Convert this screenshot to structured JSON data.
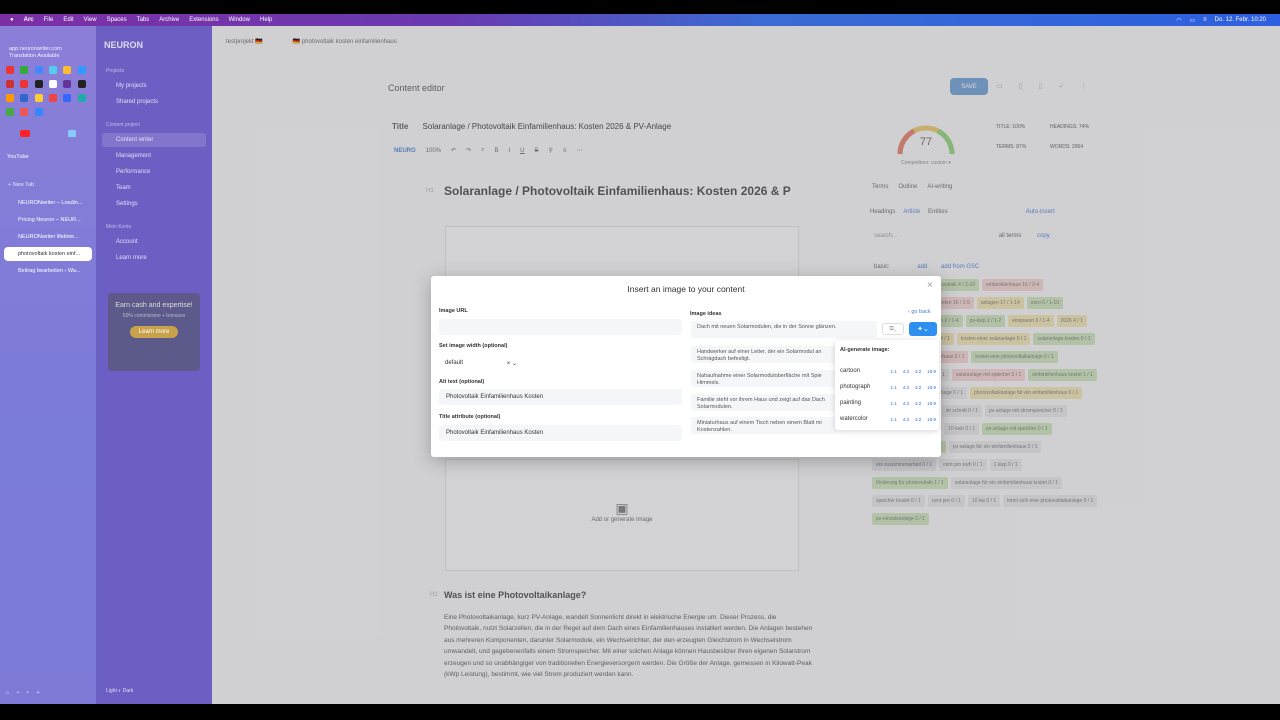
{
  "menubar": {
    "app": "Arc",
    "items": [
      "File",
      "Edit",
      "View",
      "Spaces",
      "Tabs",
      "Archive",
      "Extensions",
      "Window",
      "Help"
    ],
    "datetime": "Do. 12. Febr. 10:20"
  },
  "arc": {
    "url_line1": "app.neuronwriter.com",
    "url_line2": "Translation Available",
    "youtube": "YouTube",
    "new_tab": "+ New Tab",
    "tabs": [
      {
        "label": "NEURONwriter – Loadin..."
      },
      {
        "label": "Pricing Neuron – NEUR..."
      },
      {
        "label": "NEURONwriter lifetime..."
      },
      {
        "label": "photovoltaik kosten einf..."
      },
      {
        "label": "Beitrag bearbeiten ‹ Wa..."
      }
    ],
    "theme_light": "Light",
    "theme_dark": "Dark"
  },
  "neuron": {
    "logo": "NEURON",
    "projects_title": "Projects",
    "my_projects": "My projects",
    "shared_projects": "Shared projects",
    "content_project": "Content project",
    "content_writer": "Content writer",
    "management": "Management",
    "performance": "Performance",
    "team": "Team",
    "settings": "Settings",
    "my_account_title": "Mein Konto",
    "account": "Account",
    "learn_more": "Learn more",
    "promo": {
      "heading": "Earn cash and expertise!",
      "sub": "50% commission + bonuses",
      "button": "Learn more"
    }
  },
  "main": {
    "crumb_project": "testprojekt 🇩🇪",
    "crumb_doc": "🇩🇪 photovoltaik kosten einfamilienhaus",
    "content_editor": "Content editor",
    "save": "SAVE",
    "title_label": "Title",
    "title_value": "Solaranlage / Photovoltaik Einfamilienhaus: Kosten 2026 & PV-Anlage",
    "toolbar_brand": "NEURO",
    "zoom": "100%",
    "h1_tag": "H1",
    "h1_text": "Solaranlage / Photovoltaik Einfamilienhaus: Kosten 2026 & P",
    "floating_normal": "Normal",
    "floating_comment": "Comment",
    "add_image": "Add or generate image",
    "h2_tag": "H1",
    "h2_text": "Was ist eine Photovoltaikanlage?",
    "paragraph": "Eine Photovoltaikanlage, kurz PV-Anlage, wandelt Sonnenlicht direkt in elektrische Energie um. Dieser Prozess, die Photovoltaik, nutzt Solarzellen, die in der Regel auf dem Dach eines Einfamilienhauses installiert werden. Die Anlagen bestehen aus mehreren Komponenten, darunter Solarmodule, ein Wechselrichter, der den erzeugten Gleichstrom in Wechselstrom umwandelt, und gegebenenfalls einem Stromspeicher. Mit einer solchen Anlage können Hausbesitzer ihren eigenen Solarstrom erzeugen und so unabhängiger von traditionellen Energieversorgern werden. Die Größe der Anlage, gemessen in Kilowatt-Peak (kWp Leistung), bestimmt, wie viel Strom produziert werden kann."
  },
  "right": {
    "score": "77",
    "competitors": "Competitors: custom ▾",
    "title_stat": "TITLE: 100%",
    "headings_stat": "HEADINGS: 74%",
    "terms_stat": "TERMS: 87%",
    "words_stat": "WORDS: 2964",
    "tabs": [
      "Terms",
      "Outline",
      "AI-writing"
    ],
    "subtabs": [
      "Headings",
      "Article",
      "Entities"
    ],
    "auto_insert": "Auto-insert",
    "search_placeholder": "search...",
    "all_terms": "all terms",
    "copy": "copy",
    "basic": "basic:",
    "add": "add",
    "add_from_gsc": "add from GSC",
    "chips": [
      {
        "t": "pv-anlage 28 / 3-20",
        "c": "y"
      },
      {
        "t": "photovoltaik 4 / 2-10",
        "c": "g"
      },
      {
        "t": "einfamilienhaus 16 / 2-4",
        "c": "r"
      },
      {
        "t": "stromspeicher 6 / 2-12",
        "c": "g"
      },
      {
        "t": "kosten 16 / 1-5",
        "c": "r"
      },
      {
        "t": "anlagen 17 / 1-14",
        "c": "y"
      },
      {
        "t": "euro 6 / 1-10",
        "c": "g"
      },
      {
        "t": "10 kwp 4 / 1-3",
        "c": "g"
      },
      {
        "t": "pv-anlagen 2 / 1-4",
        "c": "g"
      },
      {
        "t": "pv-kwp 2 / 1-2",
        "c": "g"
      },
      {
        "t": "einsparen 0 / 1-4",
        "c": "y"
      },
      {
        "t": "2026 4 / 1",
        "c": "y"
      },
      {
        "t": "20 kwp 2 / 1",
        "c": "g"
      },
      {
        "t": "mein strom 4 / 1",
        "c": "y"
      },
      {
        "t": "kosten einer solaranlage 0 / 1",
        "c": "y"
      },
      {
        "t": "solaranlage kosten 0 / 1",
        "c": "g"
      },
      {
        "t": "solaranlage für ein einfamilienhaus 0 / 1",
        "c": "r"
      },
      {
        "t": "kostet eine photovoltaikanlage 0 / 1",
        "c": "g"
      },
      {
        "t": "photovoltaikanlage kosten 0 / 1",
        "c": ""
      },
      {
        "t": "solaranlage mit speicher 0 / 1",
        "c": "r"
      },
      {
        "t": "einfamilienhaus kostet 1 / 1",
        "c": "g"
      },
      {
        "t": "kosten für eine photovoltaikanlage 0 / 1",
        "c": ""
      },
      {
        "t": "photovoltaikanlage für ein einfamilienhaus 0 / 1",
        "c": "y"
      },
      {
        "t": "kostet eine pv-anlage 0 / 1",
        "c": ""
      },
      {
        "t": "im schnitt 0 / 1",
        "c": ""
      },
      {
        "t": "pv-anlage mit stromspeicher 0 / 1",
        "c": ""
      },
      {
        "t": "kosten für photovoltaik 0 / 1",
        "c": ""
      },
      {
        "t": "10 kwh 0 / 1",
        "c": ""
      },
      {
        "t": "pv-anlage mit speicher 0 / 1",
        "c": "g"
      },
      {
        "t": "pv-anlage ohne speicher 1 / 1",
        "c": "g"
      },
      {
        "t": "pv-anlage für ein einfamilienhaus 0 / 1",
        "c": ""
      },
      {
        "t": "eni zusammenarbeit 0 / 1",
        "c": ""
      },
      {
        "t": "cent pro kwh 0 / 1",
        "c": ""
      },
      {
        "t": "1 kwp 0 / 1",
        "c": ""
      },
      {
        "t": "förderung für photovoltaik 1 / 1",
        "c": "g"
      },
      {
        "t": "solaranlage für ein einfamilienhaus kostet 0 / 1",
        "c": ""
      },
      {
        "t": "speicher kostet 0 / 1",
        "c": ""
      },
      {
        "t": "cent pro 0 / 1",
        "c": ""
      },
      {
        "t": "10 kw 0 / 1",
        "c": ""
      },
      {
        "t": "lohnt sich eine photovoltaikanlage 0 / 1",
        "c": ""
      },
      {
        "t": "pv-einsatzanlage 0 / 1",
        "c": "g"
      }
    ]
  },
  "modal": {
    "title": "Insert an image to your content",
    "image_url_label": "Image URL",
    "image_url_value": "",
    "width_label": "Set image width (optional)",
    "width_value": "default",
    "alt_label": "Alt text (optional)",
    "alt_value": "Photovoltaik Einfamilienhaus Kosten",
    "title_attr_label": "Title attribute (optional)",
    "title_attr_value": "Photovoltaik Einfamilienhaus Kosten",
    "ideas_label": "Image ideas",
    "go_back": "‹ go back",
    "ideas": [
      "Dach mit neuen Solarmodulen, die in der Sonne glänzen.",
      "Handwerker auf einer Leiter, der ein Solarmodul an Schrägdach befestigt.",
      "Nahaufnahme einer Solarmoduloberfläche mit Spie Himmels.",
      "Familie steht vor ihrem Haus und zeigt auf das Dach Solarmodulen.",
      "Miniaturhaus auf einem Tisch neben einem Blatt mi Kostenzahlen."
    ],
    "ai_generate_label": "AI-generate image:",
    "styles": [
      "cartoon",
      "photograph",
      "painting",
      "watercolor"
    ],
    "ratios": [
      "1:1",
      "4:3",
      "3:2",
      "16:9"
    ]
  }
}
